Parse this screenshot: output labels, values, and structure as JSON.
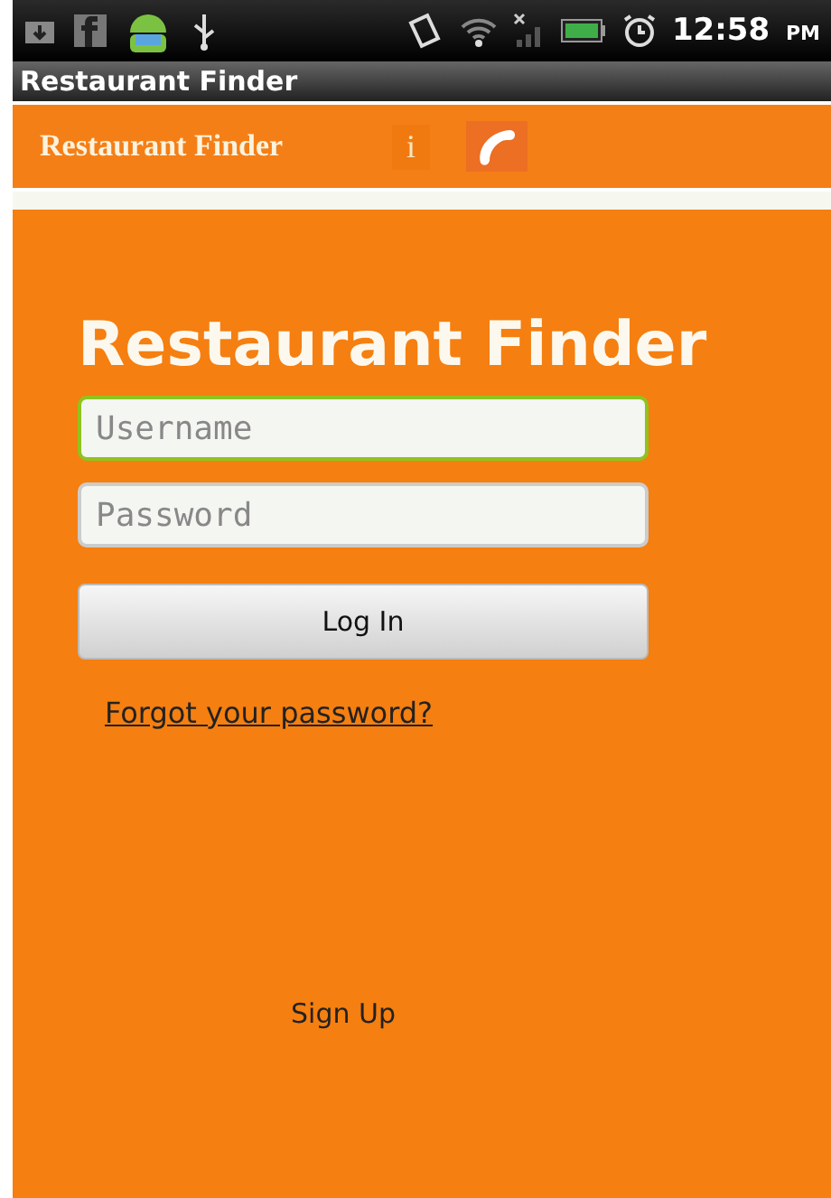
{
  "status_bar": {
    "time": "12:58",
    "meridiem": "PM"
  },
  "window": {
    "title": "Restaurant Finder"
  },
  "toolbar": {
    "title": "Restaurant Finder",
    "info": "i"
  },
  "login": {
    "heading": "Restaurant Finder",
    "fields": [
      {
        "placeholder": "Username",
        "focused": true
      },
      {
        "placeholder": "Password",
        "focused": false
      }
    ],
    "button": "Log In",
    "forgot_link": "Forgot your password?",
    "signup_link": "Sign Up"
  }
}
